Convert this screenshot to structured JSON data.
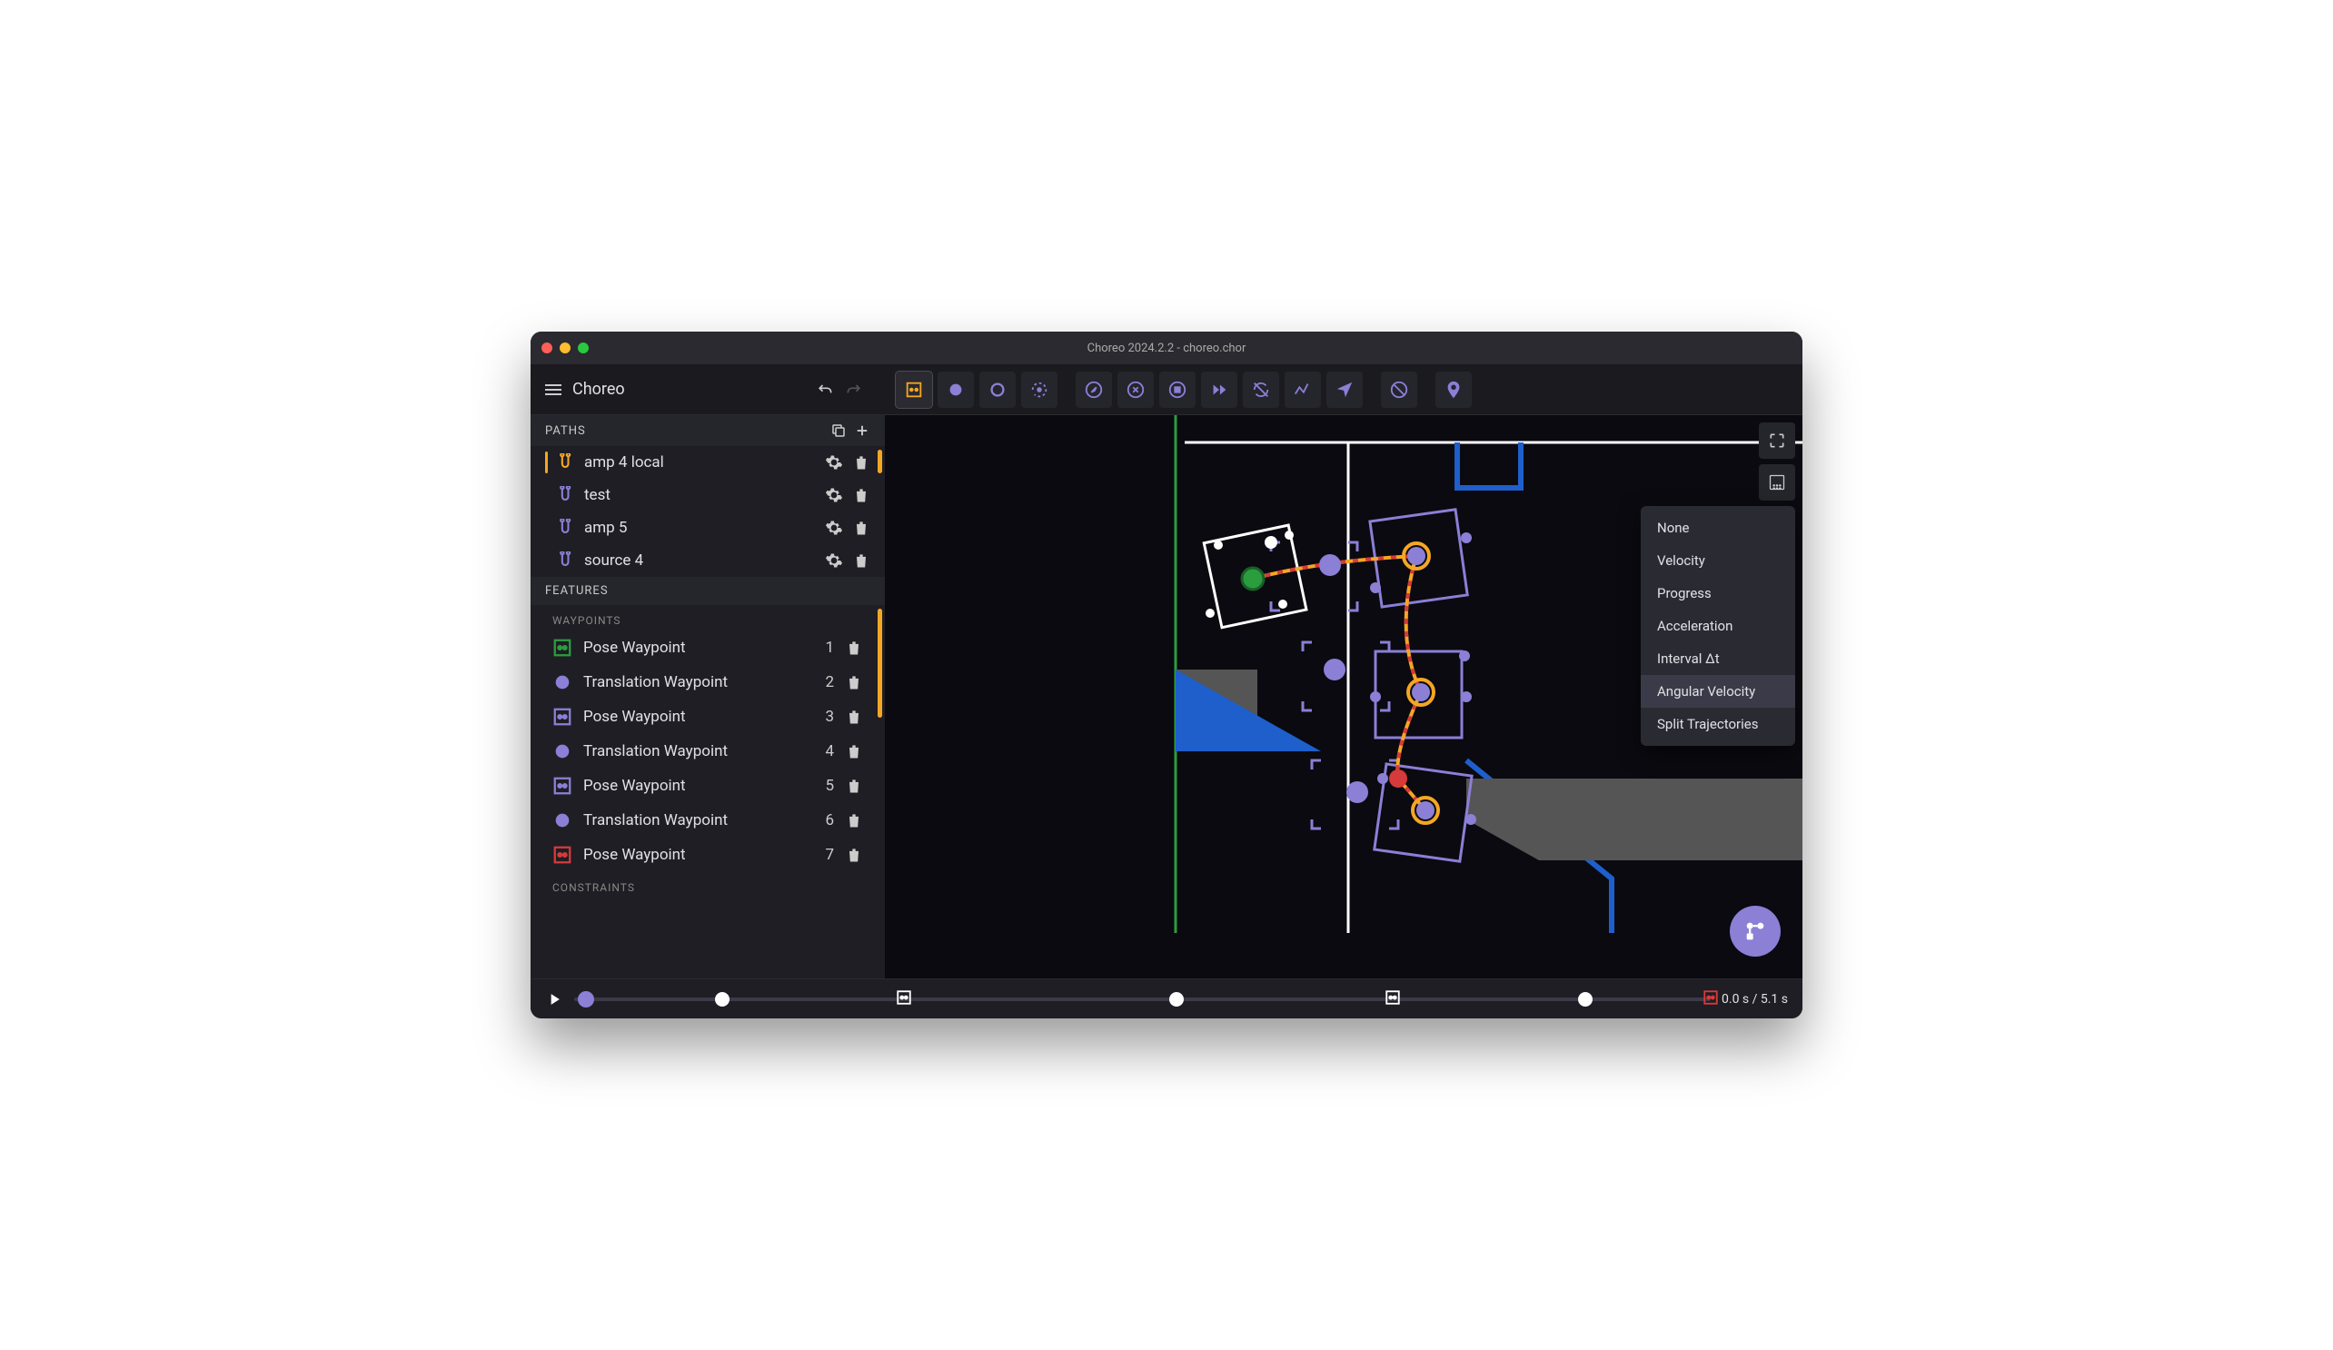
{
  "window": {
    "title": "Choreo 2024.2.2 - choreo.chor"
  },
  "header": {
    "app_name": "Choreo"
  },
  "colors": {
    "accent": "#8b7fd6",
    "warning": "#f5a623",
    "green": "#2a9d3f",
    "red": "#d63a3a"
  },
  "toolbar": {
    "tools": [
      {
        "name": "pose-waypoint-box",
        "active": true,
        "color": "#f5a623"
      },
      {
        "name": "translation-dot",
        "color": "#8b7fd6"
      },
      {
        "name": "translation-ring",
        "color": "#8b7fd6"
      },
      {
        "name": "rotate-target",
        "color": "#8b7fd6"
      },
      {
        "sep": true
      },
      {
        "name": "compass",
        "color": "#8b7fd6"
      },
      {
        "name": "cancel-circle",
        "color": "#8b7fd6"
      },
      {
        "name": "stop-circle",
        "color": "#8b7fd6"
      },
      {
        "name": "fast-forward",
        "color": "#8b7fd6"
      },
      {
        "name": "no-sync",
        "color": "#8b7fd6"
      },
      {
        "name": "polyline",
        "color": "#8b7fd6"
      },
      {
        "name": "cursor-nav",
        "color": "#8b7fd6"
      },
      {
        "sep": true
      },
      {
        "name": "no-entry",
        "color": "#8b7fd6"
      },
      {
        "sep": true
      },
      {
        "name": "location-pin",
        "color": "#8b7fd6"
      }
    ]
  },
  "sidebar": {
    "paths_label": "PATHS",
    "features_label": "FEATURES",
    "waypoints_label": "WAYPOINTS",
    "constraints_label": "CONSTRAINTS",
    "paths": [
      {
        "name": "amp 4 local",
        "selected": true,
        "color": "#f5a623"
      },
      {
        "name": "test",
        "selected": false,
        "color": "#8b7fd6"
      },
      {
        "name": "amp 5",
        "selected": false,
        "color": "#8b7fd6"
      },
      {
        "name": "source 4",
        "selected": false,
        "color": "#8b7fd6"
      }
    ],
    "waypoints": [
      {
        "type": "pose-box",
        "label": "Pose Waypoint",
        "num": "1",
        "color": "#2a9d3f"
      },
      {
        "type": "dot",
        "label": "Translation Waypoint",
        "num": "2",
        "color": "#8b7fd6"
      },
      {
        "type": "pose-box",
        "label": "Pose Waypoint",
        "num": "3",
        "color": "#8b7fd6"
      },
      {
        "type": "dot",
        "label": "Translation Waypoint",
        "num": "4",
        "color": "#8b7fd6"
      },
      {
        "type": "pose-box",
        "label": "Pose Waypoint",
        "num": "5",
        "color": "#8b7fd6"
      },
      {
        "type": "dot",
        "label": "Translation Waypoint",
        "num": "6",
        "color": "#8b7fd6"
      },
      {
        "type": "pose-box",
        "label": "Pose Waypoint",
        "num": "7",
        "color": "#d63a3a"
      }
    ]
  },
  "dropdown": {
    "items": [
      {
        "label": "None"
      },
      {
        "label": "Velocity"
      },
      {
        "label": "Progress"
      },
      {
        "label": "Acceleration"
      },
      {
        "label": "Interval Δt"
      },
      {
        "label": "Angular Velocity",
        "selected": true
      },
      {
        "label": "Split Trajectories"
      }
    ]
  },
  "timeline": {
    "current": "0.0 s",
    "total": "5.1 s",
    "display": "0.0 s / 5.1 s",
    "markers": [
      {
        "pos": 1,
        "type": "playhead"
      },
      {
        "pos": 13,
        "type": "dot"
      },
      {
        "pos": 29,
        "type": "box"
      },
      {
        "pos": 53,
        "type": "dot"
      },
      {
        "pos": 72,
        "type": "box"
      },
      {
        "pos": 89,
        "type": "dot"
      },
      {
        "pos": 100,
        "type": "box-red"
      }
    ]
  }
}
